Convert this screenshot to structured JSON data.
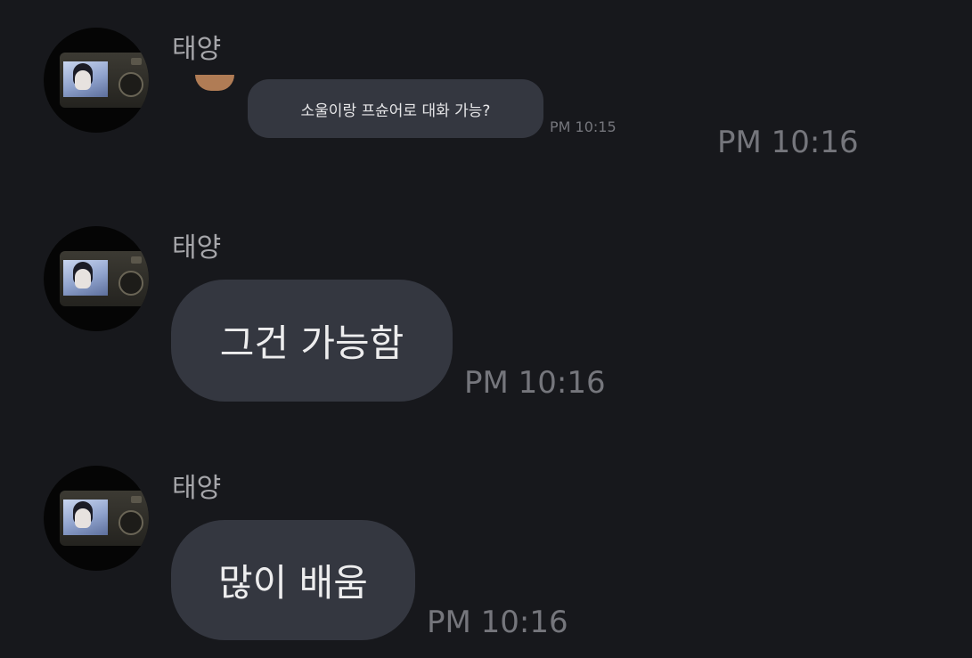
{
  "messages": [
    {
      "sender": "태양",
      "quoted_text": "소울이랑 프슌어로 대화 가능?",
      "quoted_time": "PM 10:15",
      "time": "PM 10:16"
    },
    {
      "sender": "태양",
      "text": "그건 가능함",
      "time": "PM 10:16"
    },
    {
      "sender": "태양",
      "text": "많이 배움",
      "time": "PM 10:16"
    }
  ],
  "colors": {
    "background": "#17181c",
    "bubble": "#343740",
    "text": "#ededee",
    "sender": "#a6a6aa",
    "timestamp": "#75767c"
  }
}
